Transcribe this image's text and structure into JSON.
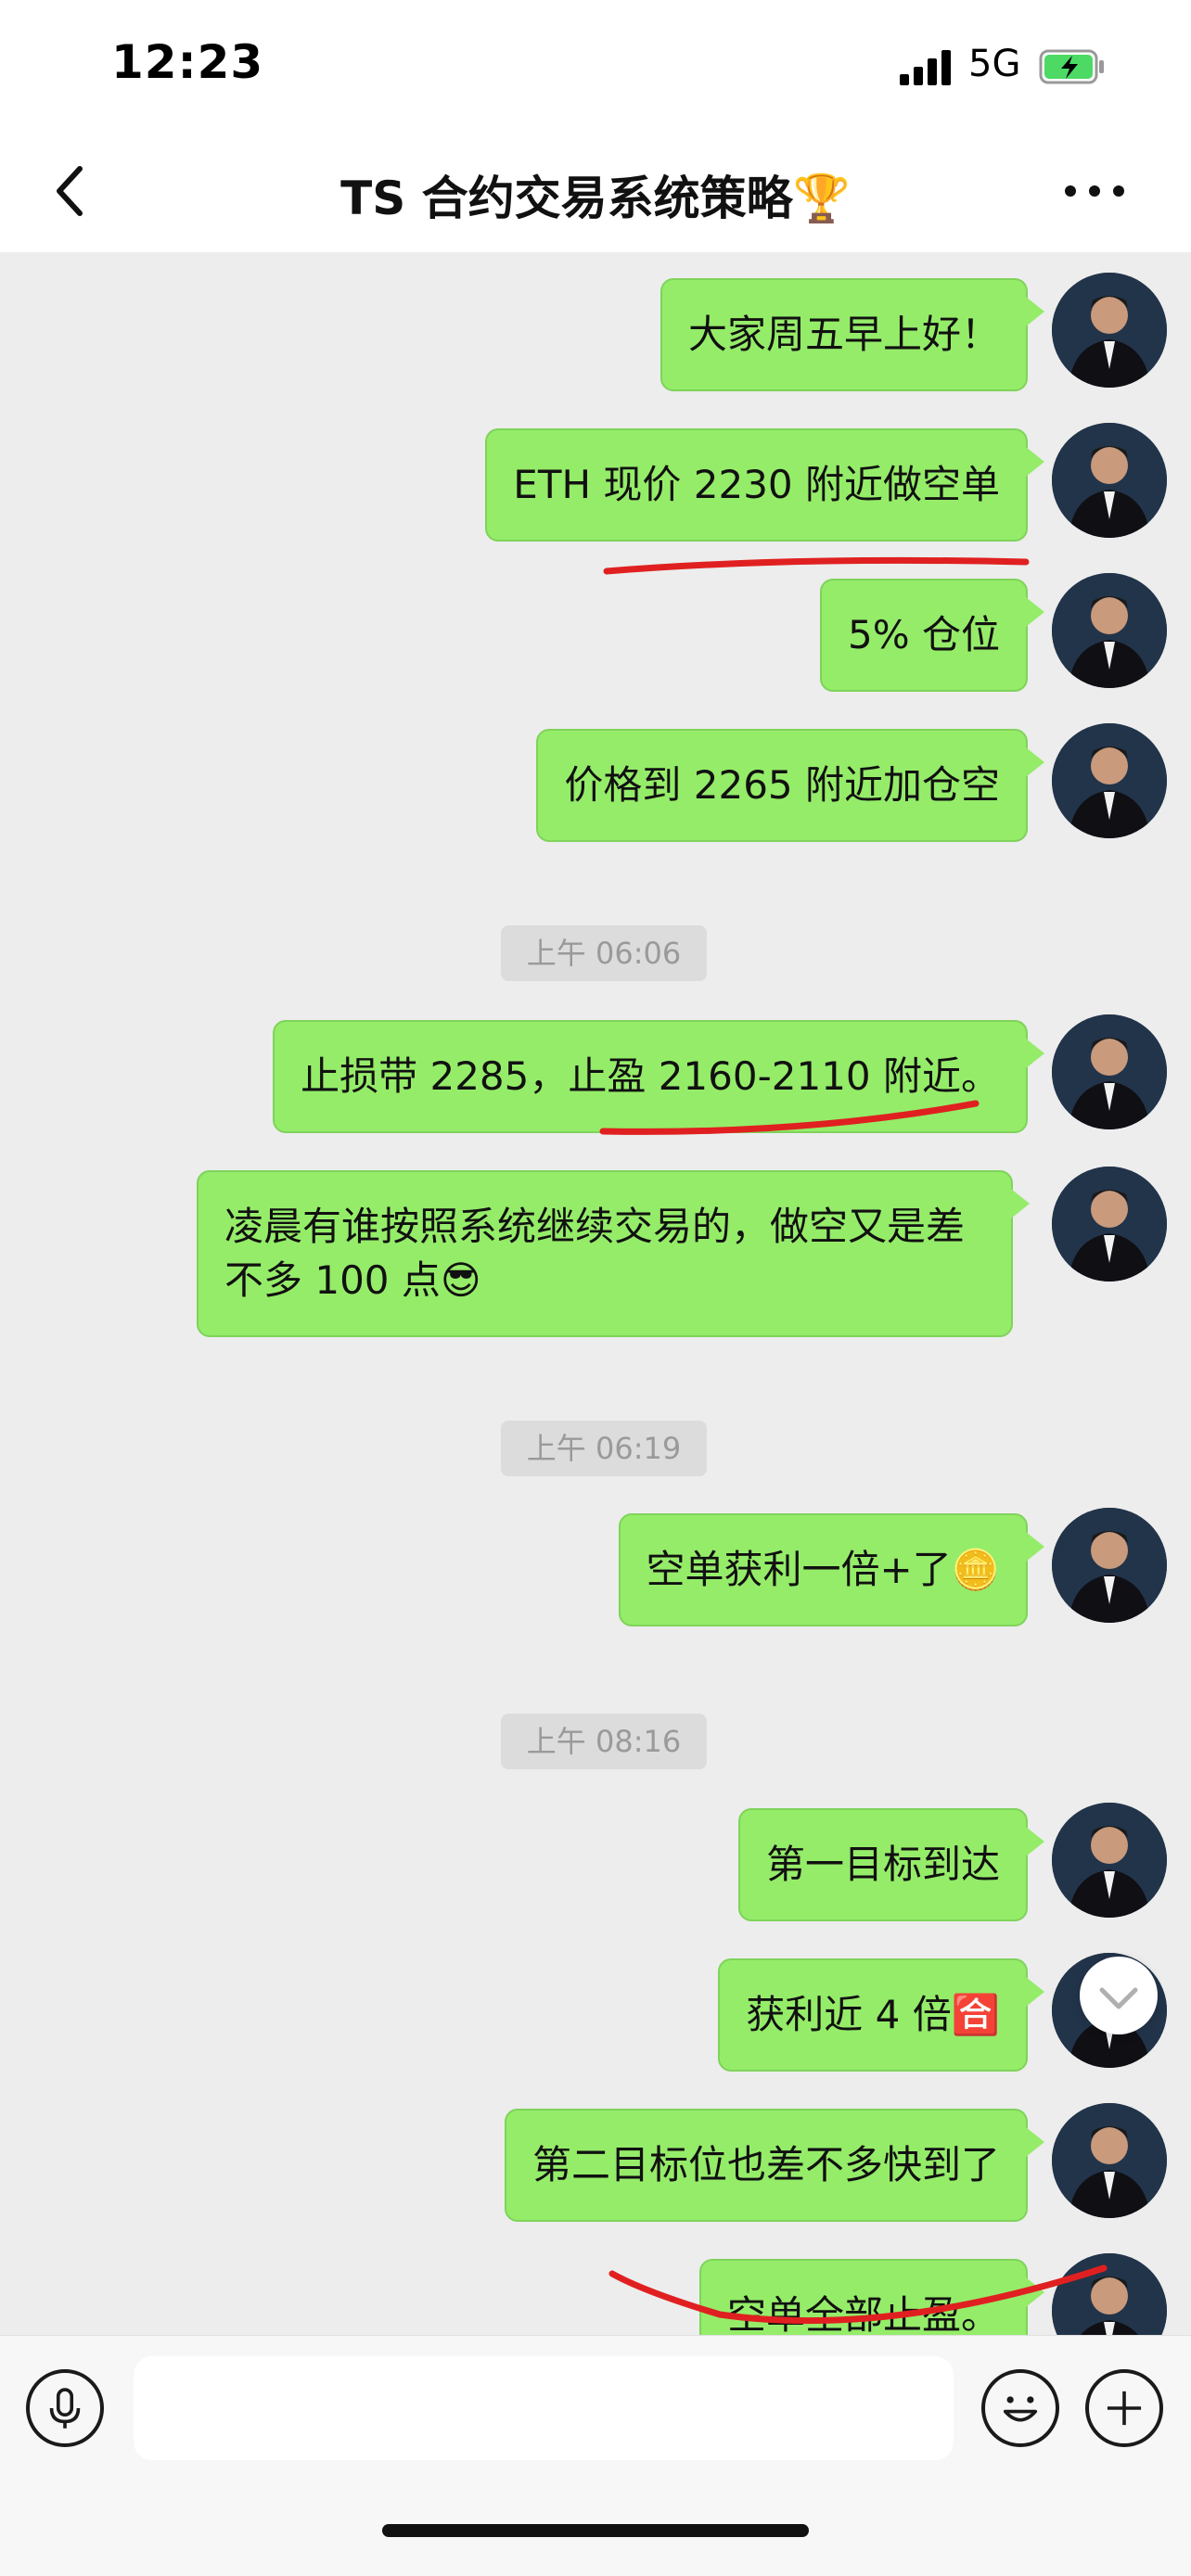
{
  "status_bar": {
    "time": "12:23",
    "network": "5G"
  },
  "nav": {
    "title": "TS 合约交易系统策略🏆"
  },
  "messages": [
    {
      "text": "大家周五早上好！"
    },
    {
      "text": "ETH 现价 2230 附近做空单"
    },
    {
      "text": "5% 仓位"
    },
    {
      "text": "价格到 2265 附近加仓空"
    },
    {
      "text": "止损带 2285，止盈 2160-2110 附近。"
    },
    {
      "line1": "凌晨有谁按照系统继续交易的，做空又是差",
      "line2": "不多 100 点😎"
    },
    {
      "text": "空单获利一倍+了🪙"
    },
    {
      "text": "第一目标到达"
    },
    {
      "text": "获利近 4 倍🈴"
    },
    {
      "text": "第二目标位也差不多快到了"
    },
    {
      "text": "空单全部止盈。"
    }
  ],
  "timestamps": [
    "上午 06:06",
    "上午 06:19",
    "上午 08:16"
  ],
  "input": {
    "placeholder": ""
  }
}
